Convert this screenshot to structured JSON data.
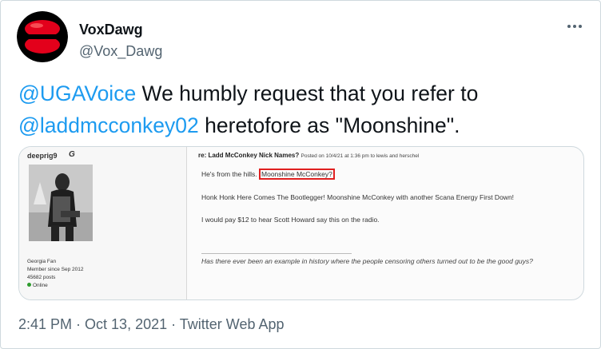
{
  "author": {
    "display_name": "VoxDawg",
    "handle": "@Vox_Dawg"
  },
  "tweet": {
    "mention_1": "@UGAVoice",
    "text_1": " We humbly request that you refer to ",
    "mention_2": "@laddmcconkey02",
    "text_2": " heretofore as \"Moonshine\"."
  },
  "forum_post": {
    "username": "deeprig9",
    "user_badge": "G",
    "user_meta": [
      "Georgia Fan",
      "Member since Sep 2012",
      "45682 posts"
    ],
    "status": "Online",
    "title": "re: Ladd McConkey Nick Names?",
    "date": "Posted on 10/4/21 at 1:36 pm to lewis and herschel",
    "line_1_prefix": "He's from the hills. ",
    "line_1_highlight": "Moonshine McConkey?",
    "line_2": "Honk Honk Here Comes The Bootlegger! Moonshine McConkey with another Scana Energy First Down!",
    "line_3": "I would pay $12 to hear Scott Howard say this on the radio.",
    "signature": "Has there ever been an example in history where the people censoring others turned out to be the good guys?",
    "highlight_color": "#e02020"
  },
  "footer": {
    "time": "2:41 PM",
    "sep_1": " · ",
    "date": "Oct 13, 2021",
    "sep_2": " · ",
    "source": "Twitter Web App"
  },
  "colors": {
    "link": "#1d9bf0",
    "text": "#0f1419",
    "secondary": "#536471",
    "avatar_red": "#e3001b"
  },
  "icons": [
    "avatar-logo",
    "more-options-icon",
    "online-status-icon"
  ]
}
